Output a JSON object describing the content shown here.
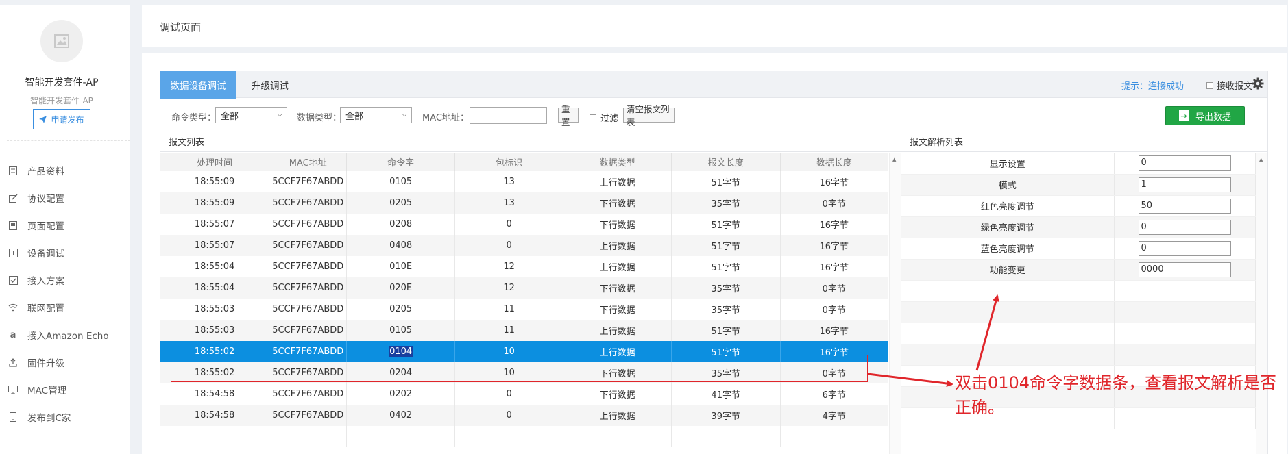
{
  "sidebar": {
    "product_name": "智能开发套件-AP",
    "product_subtitle": "智能开发套件-AP",
    "apply_button": "申请发布",
    "nav": [
      {
        "label": "产品资料",
        "icon": "document-icon"
      },
      {
        "label": "协议配置",
        "icon": "edit-icon"
      },
      {
        "label": "页面配置",
        "icon": "page-icon"
      },
      {
        "label": "设备调试",
        "icon": "debug-icon"
      },
      {
        "label": "接入方案",
        "icon": "checkbox-icon"
      },
      {
        "label": "联网配置",
        "icon": "wifi-icon"
      },
      {
        "label": "接入Amazon Echo",
        "icon": "amazon-icon"
      },
      {
        "label": "固件升级",
        "icon": "upload-icon"
      },
      {
        "label": "MAC管理",
        "icon": "monitor-icon"
      },
      {
        "label": "发布到C家",
        "icon": "mobile-icon"
      }
    ]
  },
  "header": {
    "title": "调试页面"
  },
  "tabs": [
    {
      "label": "数据设备调试",
      "active": true
    },
    {
      "label": "升级调试",
      "active": false
    }
  ],
  "status": {
    "hint": "提示：连接成功",
    "receive_label": "接收报文"
  },
  "filters": {
    "cmd_type_label": "命令类型：",
    "cmd_type_value": "全部",
    "data_type_label": "数据类型：",
    "data_type_value": "全部",
    "mac_label": "MAC地址：",
    "mac_value": "",
    "reset_button": "重置",
    "filter_label": "过滤",
    "clear_button": "清空报文列表",
    "export_button": "导出数据"
  },
  "packet_list": {
    "title": "报文列表",
    "columns": [
      "处理时间",
      "MAC地址",
      "命令字",
      "包标识",
      "数据类型",
      "报文长度",
      "数据长度"
    ],
    "rows": [
      [
        "18:55:09",
        "5CCF7F67ABDD",
        "0105",
        "13",
        "上行数据",
        "51字节",
        "16字节"
      ],
      [
        "18:55:09",
        "5CCF7F67ABDD",
        "0205",
        "13",
        "下行数据",
        "35字节",
        "0字节"
      ],
      [
        "18:55:07",
        "5CCF7F67ABDD",
        "0208",
        "0",
        "下行数据",
        "51字节",
        "16字节"
      ],
      [
        "18:55:07",
        "5CCF7F67ABDD",
        "0408",
        "0",
        "上行数据",
        "51字节",
        "16字节"
      ],
      [
        "18:55:04",
        "5CCF7F67ABDD",
        "010E",
        "12",
        "上行数据",
        "51字节",
        "16字节"
      ],
      [
        "18:55:04",
        "5CCF7F67ABDD",
        "020E",
        "12",
        "下行数据",
        "35字节",
        "0字节"
      ],
      [
        "18:55:03",
        "5CCF7F67ABDD",
        "0205",
        "11",
        "下行数据",
        "35字节",
        "0字节"
      ],
      [
        "18:55:03",
        "5CCF7F67ABDD",
        "0105",
        "11",
        "上行数据",
        "51字节",
        "16字节"
      ],
      [
        "18:55:02",
        "5CCF7F67ABDD",
        "0104",
        "10",
        "上行数据",
        "51字节",
        "16字节"
      ],
      [
        "18:55:02",
        "5CCF7F67ABDD",
        "0204",
        "10",
        "下行数据",
        "35字节",
        "0字节"
      ],
      [
        "18:54:58",
        "5CCF7F67ABDD",
        "0202",
        "0",
        "下行数据",
        "41字节",
        "6字节"
      ],
      [
        "18:54:58",
        "5CCF7F67ABDD",
        "0402",
        "0",
        "上行数据",
        "39字节",
        "4字节"
      ],
      [
        "",
        "",
        "",
        "",
        "",
        "",
        ""
      ]
    ],
    "selected_row": 8
  },
  "parse_list": {
    "title": "报文解析列表",
    "rows": [
      {
        "name": "显示设置",
        "value": "0"
      },
      {
        "name": "模式",
        "value": "1"
      },
      {
        "name": "红色亮度调节",
        "value": "50"
      },
      {
        "name": "绿色亮度调节",
        "value": "0"
      },
      {
        "name": "蓝色亮度调节",
        "value": "0"
      },
      {
        "name": "功能变更",
        "value": "0000"
      },
      {
        "name": "",
        "value": null
      },
      {
        "name": "",
        "value": null
      },
      {
        "name": "",
        "value": null
      },
      {
        "name": "",
        "value": null
      },
      {
        "name": "",
        "value": null
      },
      {
        "name": "",
        "value": null
      },
      {
        "name": "",
        "value": null
      }
    ]
  },
  "annotation": {
    "text": "双击0104命令字数据条，查看报文解析是否正确。",
    "color": "#e0262b"
  },
  "colors": {
    "accent": "#5aa5e8",
    "selected_row": "#0c8fe0",
    "export_green": "#21a645",
    "link_blue": "#3b8fe0"
  }
}
